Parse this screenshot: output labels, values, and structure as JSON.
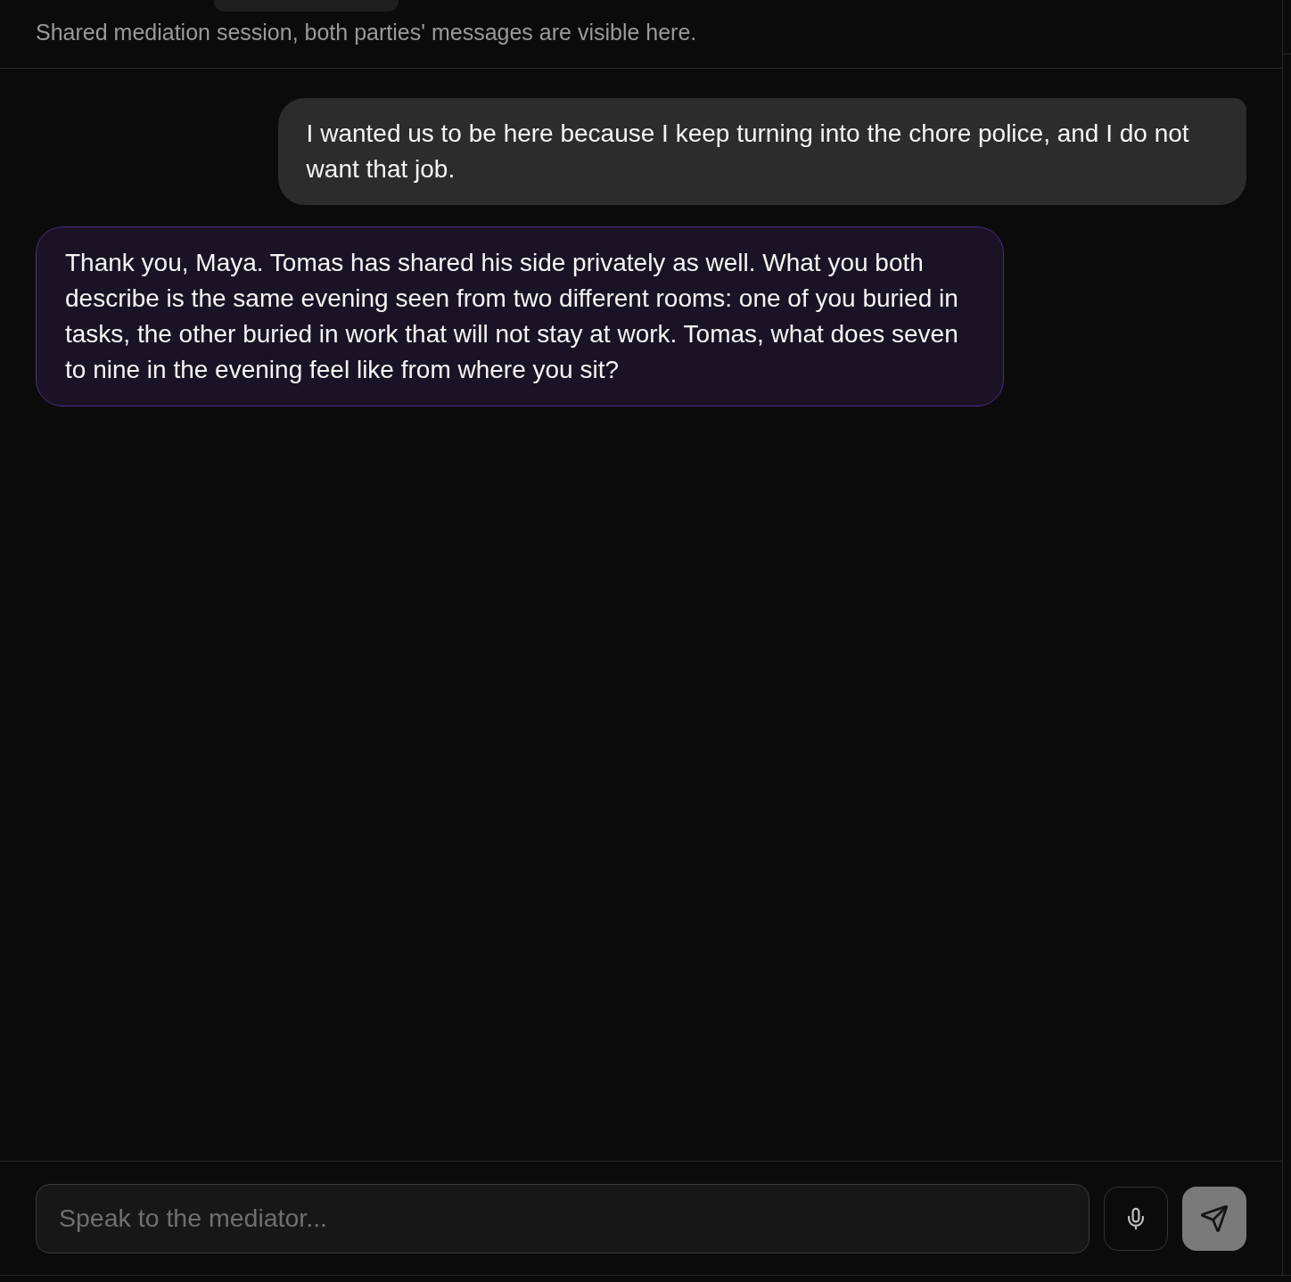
{
  "header": {
    "subtitle": "Shared mediation session, both parties' messages are visible here."
  },
  "messages": [
    {
      "kind": "user",
      "text": "I wanted us to be here because I keep turning into the chore police, and I do not want that job."
    },
    {
      "kind": "mediator",
      "text": "Thank you, Maya. Tomas has shared his side privately as well. What you both describe is the same evening seen from two different rooms: one of you buried in tasks, the other buried in work that will not stay at work. Tomas, what does seven to nine in the evening feel like from where you sit?"
    }
  ],
  "composer": {
    "placeholder": "Speak to the mediator..."
  }
}
